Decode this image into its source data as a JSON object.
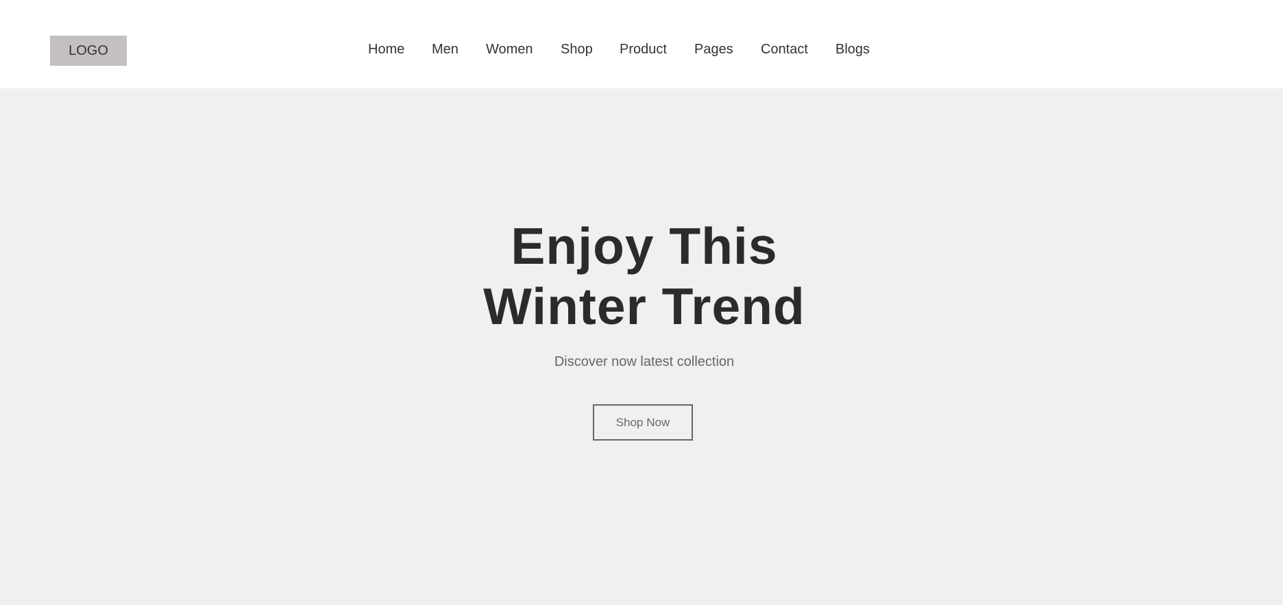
{
  "header": {
    "logo": "LOGO",
    "nav": [
      "Home",
      "Men",
      "Women",
      "Shop",
      "Product",
      "Pages",
      "Contact",
      "Blogs"
    ]
  },
  "hero": {
    "title_line1": "Enjoy This",
    "title_line2": "Winter Trend",
    "subtitle": "Discover now latest collection",
    "cta_label": "Shop Now"
  },
  "colors": {
    "header_bg": "#ffffff",
    "hero_bg": "#f0f0f0",
    "logo_bg": "#c4bfc3",
    "title_text": "#2b2b2b",
    "muted_text": "#666666"
  }
}
